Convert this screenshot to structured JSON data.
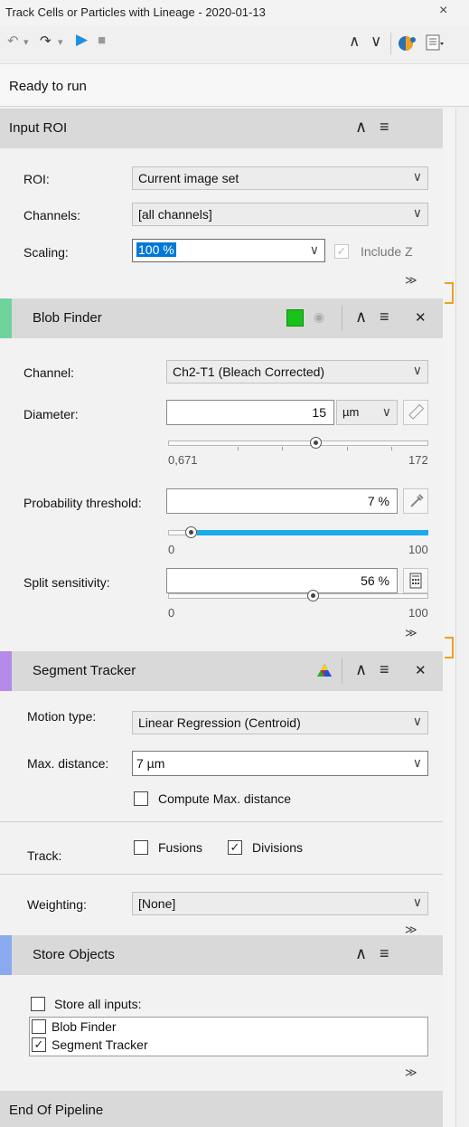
{
  "window": {
    "title": "Track Cells or Particles with Lineage - 2020-01-13",
    "close": "×"
  },
  "toolbar": {
    "undo": "↶",
    "undo_drop": "▾",
    "redo": "↷",
    "redo_drop": "▾",
    "run": "▶",
    "stop": "■",
    "up": "∧",
    "down": "∨"
  },
  "status": "Ready to run",
  "input_roi": {
    "title": "Input ROI",
    "roi_label": "ROI:",
    "roi_value": "Current image set",
    "channels_label": "Channels:",
    "channels_value": "[all channels]",
    "scaling_label": "Scaling:",
    "scaling_value": "100 %",
    "include_z_label": "Include Z"
  },
  "blob_finder": {
    "title": "Blob Finder",
    "accent": "#6ed39c",
    "channel_label": "Channel:",
    "channel_value": "Ch2-T1 (Bleach Corrected)",
    "diameter_label": "Diameter:",
    "diameter_value": "15",
    "diameter_unit": "µm",
    "diameter_min": "0,671",
    "diameter_max": "172",
    "diameter_slider_fraction": 0.57,
    "prob_label": "Probability threshold:",
    "prob_value": "7 %",
    "prob_min": "0",
    "prob_max": "100",
    "prob_slider_fraction": 0.07,
    "split_label": "Split sensitivity:",
    "split_value": "56 %",
    "split_min": "0",
    "split_max": "100",
    "split_slider_fraction": 0.56,
    "swatch_color": "#19c219",
    "slider_color": "#1aabe8"
  },
  "segment_tracker": {
    "title": "Segment Tracker",
    "accent": "#b48be8",
    "motion_label": "Motion type:",
    "motion_value": "Linear Regression (Centroid)",
    "maxdist_label": "Max. distance:",
    "maxdist_value": "7 µm",
    "compute_label": "Compute Max. distance",
    "track_label": "Track:",
    "fusions_label": "Fusions",
    "divisions_label": "Divisions",
    "weighting_label": "Weighting:",
    "weighting_value": "[None]"
  },
  "store_objects": {
    "title": "Store Objects",
    "accent": "#8aaaf0",
    "store_all_label": "Store all inputs:",
    "items": [
      {
        "label": "Blob Finder",
        "checked": false
      },
      {
        "label": "Segment Tracker",
        "checked": true
      }
    ]
  },
  "end": {
    "title": "End Of Pipeline"
  },
  "glyphs": {
    "chev": "∨",
    "check": "✓",
    "expand": "≫",
    "menu": "≡",
    "collapse": "∧",
    "close": "✕",
    "eye": "◉"
  }
}
